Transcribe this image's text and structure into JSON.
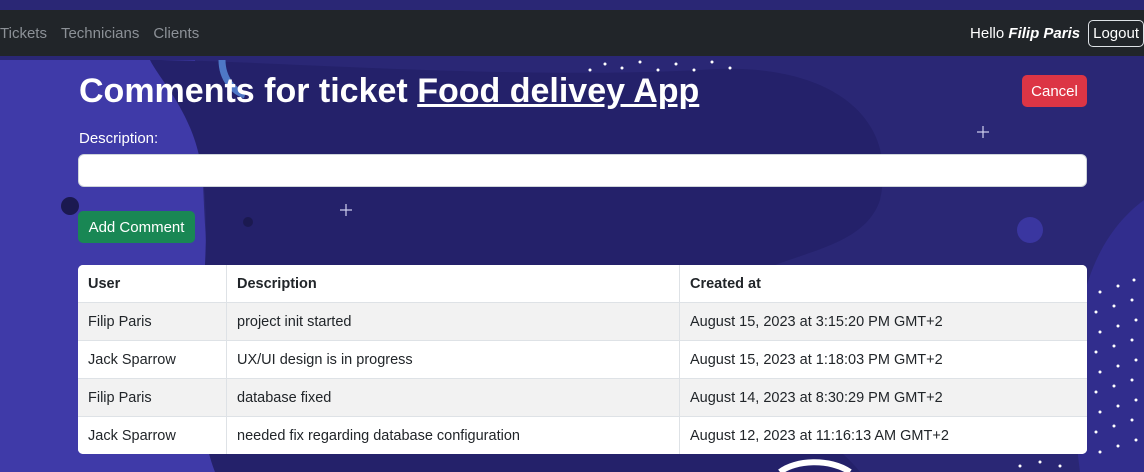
{
  "nav": {
    "links": [
      "Tickets",
      "Technicians",
      "Clients"
    ],
    "greeting": "Hello",
    "user_name": "Filip Paris",
    "logout_label": "Logout"
  },
  "page": {
    "title_prefix": "Comments for ticket",
    "ticket_name": "Food delivey App",
    "cancel_label": "Cancel",
    "description_label": "Description:",
    "description_value": "",
    "add_comment_label": "Add Comment"
  },
  "table": {
    "headers": [
      "User",
      "Description",
      "Created at"
    ],
    "rows": [
      [
        "Filip Paris",
        "project init started",
        "August 15, 2023 at 3:15:20 PM GMT+2"
      ],
      [
        "Jack Sparrow",
        "UX/UI design is in progress",
        "August 15, 2023 at 1:18:03 PM GMT+2"
      ],
      [
        "Filip Paris",
        "database fixed",
        "August 14, 2023 at 8:30:29 PM GMT+2"
      ],
      [
        "Jack Sparrow",
        "needed fix regarding database configuration",
        "August 12, 2023 at 11:16:13 AM GMT+2"
      ]
    ]
  },
  "colors": {
    "navbar": "#212529",
    "background": "#2a2775",
    "cancel": "#dc3545",
    "add": "#198754"
  }
}
